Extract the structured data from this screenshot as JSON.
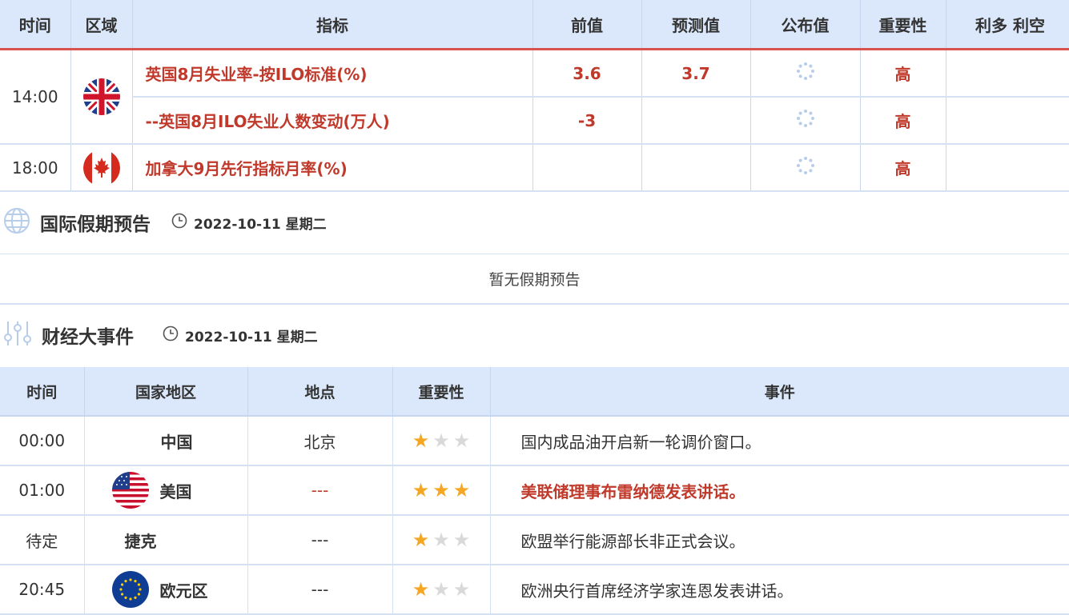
{
  "indicators": {
    "headers": {
      "time": "时间",
      "region": "区域",
      "indicator": "指标",
      "previous": "前值",
      "forecast": "预测值",
      "actual": "公布值",
      "importance": "重要性",
      "impact": "利多 利空"
    },
    "rows": [
      {
        "time": "14:00",
        "flag": "uk-flag",
        "name": "英国8月失业率-按ILO标准(%)",
        "previous": "3.6",
        "forecast": "3.7",
        "importance": "高"
      },
      {
        "time": "",
        "flag": "",
        "name": "--英国8月ILO失业人数变动(万人)",
        "previous": "-3",
        "forecast": "",
        "importance": "高"
      },
      {
        "time": "18:00",
        "flag": "canada-flag",
        "name": "加拿大9月先行指标月率(%)",
        "previous": "",
        "forecast": "",
        "importance": "高"
      }
    ]
  },
  "holidays": {
    "title": "国际假期预告",
    "date": "2022-10-11 星期二",
    "empty_text": "暂无假期预告"
  },
  "events": {
    "title": "财经大事件",
    "date": "2022-10-11 星期二",
    "headers": {
      "time": "时间",
      "country": "国家地区",
      "place": "地点",
      "importance": "重要性",
      "event": "事件"
    },
    "rows": [
      {
        "time": "00:00",
        "country": "中国",
        "flag": "",
        "place": "北京",
        "stars": 1,
        "event": "国内成品油开启新一轮调价窗口。",
        "highlight": false
      },
      {
        "time": "01:00",
        "country": "美国",
        "flag": "us-flag",
        "place": "---",
        "stars": 3,
        "event": "美联储理事布雷纳德发表讲话。",
        "highlight": true
      },
      {
        "time": "待定",
        "country": "捷克",
        "flag": "",
        "place": "---",
        "stars": 1,
        "event": "欧盟举行能源部长非正式会议。",
        "highlight": false
      },
      {
        "time": "20:45",
        "country": "欧元区",
        "flag": "eu-flag",
        "place": "---",
        "stars": 1,
        "event": "欧洲央行首席经济学家连恩发表讲话。",
        "highlight": false
      }
    ]
  },
  "colors": {
    "accent_red": "#c0392b",
    "header_bg": "#dbe8fb",
    "star_on": "#f5a623",
    "star_off": "#d9d9d9"
  }
}
